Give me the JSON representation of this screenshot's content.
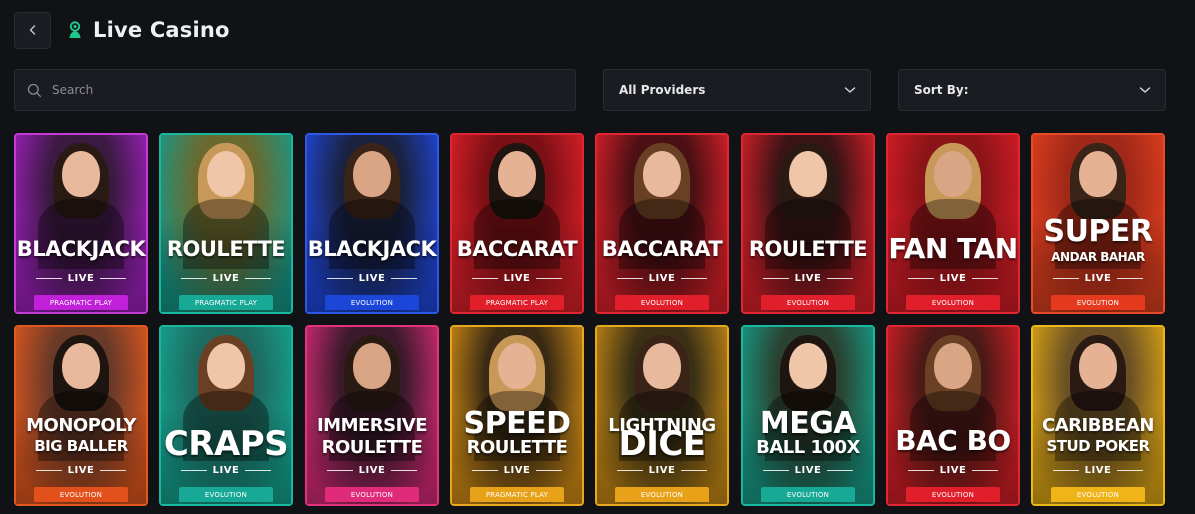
{
  "header": {
    "title": "Live Casino",
    "back_icon": "chevron-left-icon",
    "title_icon": "live-dealer-icon",
    "accent": "#22c58b"
  },
  "filters": {
    "search": {
      "placeholder": "Search",
      "value": ""
    },
    "providers": {
      "label": "All Providers"
    },
    "sort": {
      "label": "Sort By:"
    }
  },
  "games": [
    {
      "name": "BLACKJACK",
      "sub": "LIVE",
      "provider": "PRAGMATIC PLAY",
      "border": "#c63bd6",
      "bg1": "#3a1a40",
      "bg2": "#a020c0",
      "tag": "#c020d8"
    },
    {
      "name": "ROULETTE",
      "sub": "LIVE",
      "provider": "PRAGMATIC PLAY",
      "border": "#19b7a0",
      "bg1": "#6a6a30",
      "bg2": "#149a8a",
      "tag": "#17a896"
    },
    {
      "name": "BLACKJACK",
      "sub": "LIVE",
      "provider": "EVOLUTION",
      "border": "#2f58e6",
      "bg1": "#1a2240",
      "bg2": "#1f48e0",
      "tag": "#1c46d8"
    },
    {
      "name": "BACCARAT",
      "sub": "LIVE",
      "provider": "PRAGMATIC PLAY",
      "border": "#e02632",
      "bg1": "#7a1015",
      "bg2": "#e0202a",
      "tag": "#e01f2a"
    },
    {
      "name": "BACCARAT",
      "sub": "LIVE",
      "provider": "EVOLUTION",
      "border": "#e02632",
      "bg1": "#4a1014",
      "bg2": "#e0202a",
      "tag": "#e01f2a"
    },
    {
      "name": "ROULETTE",
      "sub": "LIVE",
      "provider": "EVOLUTION",
      "border": "#e02632",
      "bg1": "#3a1416",
      "bg2": "#e0202a",
      "tag": "#e01f2a"
    },
    {
      "name": "FAN TAN",
      "sub": "LIVE",
      "provider": "EVOLUTION",
      "border": "#e02632",
      "bg1": "#8a1418",
      "bg2": "#d81c26",
      "tag": "#e01f2a"
    },
    {
      "name": "SUPER",
      "name2": "ANDAR BAHAR",
      "sub": "LIVE",
      "provider": "EVOLUTION",
      "border": "#e84a2a",
      "bg1": "#a02818",
      "bg2": "#e0401e",
      "tag": "#e63a1e"
    },
    {
      "name": "MONOPOLY",
      "name2": "BIG BALLER",
      "sub": "LIVE",
      "provider": "EVOLUTION",
      "border": "#e2581e",
      "bg1": "#6a3a28",
      "bg2": "#e2581e",
      "tag": "#e2501c"
    },
    {
      "name": "CRAPS",
      "sub": "LIVE",
      "provider": "EVOLUTION",
      "border": "#19b7a0",
      "bg1": "#1e6a60",
      "bg2": "#14a592",
      "tag": "#17a896"
    },
    {
      "name": "IMMERSIVE",
      "name2": "ROULETTE",
      "sub": "LIVE",
      "provider": "EVOLUTION",
      "border": "#e3317a",
      "bg1": "#3a1a2a",
      "bg2": "#d82a78",
      "tag": "#e02a7a"
    },
    {
      "name": "SPEED",
      "name2": "ROULETTE",
      "sub": "LIVE",
      "provider": "PRAGMATIC PLAY",
      "border": "#e8a81e",
      "bg1": "#3a2a14",
      "bg2": "#d48d14",
      "tag": "#e8a21a"
    },
    {
      "name": "LIGHTNING",
      "name2": "DICE",
      "sub": "LIVE",
      "provider": "EVOLUTION",
      "border": "#e8a81e",
      "bg1": "#3a3016",
      "bg2": "#c88a14",
      "tag": "#e8a21a"
    },
    {
      "name": "MEGA",
      "name2": "BALL 100X",
      "sub": "LIVE",
      "provider": "EVOLUTION",
      "border": "#19b7a0",
      "bg1": "#2a4030",
      "bg2": "#16a08a",
      "tag": "#17a896"
    },
    {
      "name": "BAC BO",
      "sub": "LIVE",
      "provider": "EVOLUTION",
      "border": "#e02632",
      "bg1": "#4a1a16",
      "bg2": "#d81e26",
      "tag": "#e01f2a"
    },
    {
      "name": "CARIBBEAN",
      "name2": "STUD POKER",
      "sub": "LIVE",
      "provider": "EVOLUTION",
      "border": "#e8b81e",
      "bg1": "#6a5024",
      "bg2": "#e0a814",
      "tag": "#f0b418"
    }
  ]
}
